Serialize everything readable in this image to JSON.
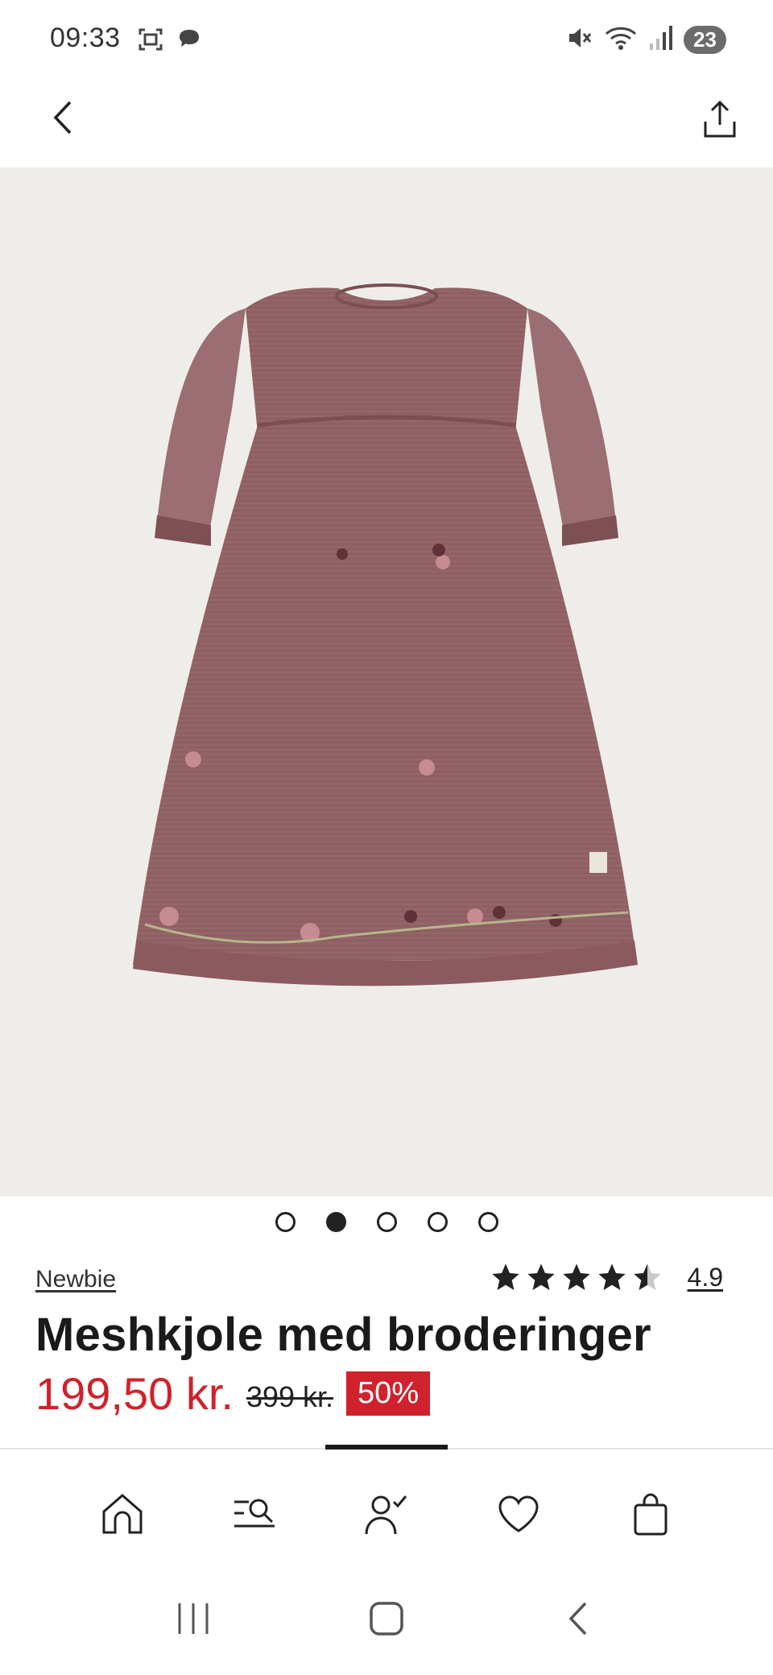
{
  "status_bar": {
    "time": "09:33",
    "battery": "23",
    "icons": [
      "screenshot-icon",
      "chat-bubble-icon",
      "mute-icon",
      "wifi-icon",
      "signal-icon"
    ]
  },
  "header": {
    "icons": [
      "chevron-left-icon",
      "share-icon"
    ]
  },
  "carousel": {
    "total": 5,
    "active_index": 1
  },
  "product": {
    "brand": "Newbie",
    "rating": "4.9",
    "rating_stars": 4.5,
    "title": "Meshkjole med broderinger",
    "sale_price": "199,50 kr.",
    "original_price": "399 kr.",
    "discount": "50%"
  },
  "colors": {
    "sale_red": "#d0222c",
    "image_background": "#efede9",
    "dress": "#8e5f63"
  },
  "bottom_nav": {
    "items": [
      "home-icon",
      "search-icon",
      "account-icon",
      "heart-icon",
      "bag-icon"
    ]
  },
  "system_nav": {
    "items": [
      "recents-icon",
      "home-button-icon",
      "back-icon"
    ]
  }
}
